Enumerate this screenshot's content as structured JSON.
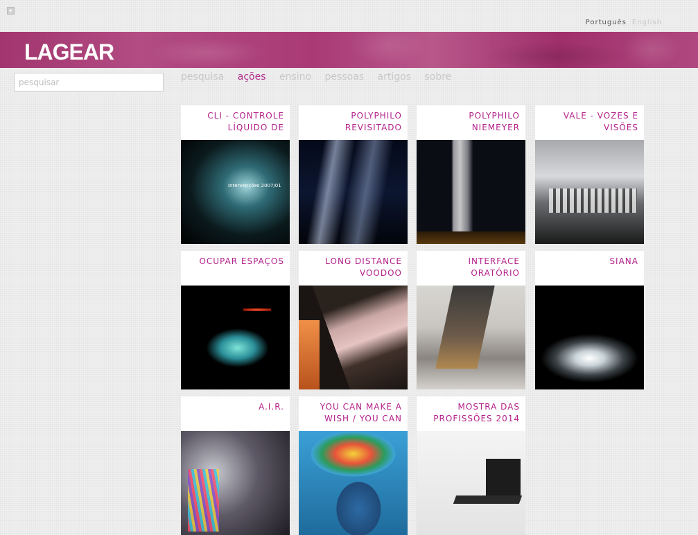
{
  "app": {
    "logo": "LAGEAR"
  },
  "languages": {
    "pt": "Português",
    "en": "English"
  },
  "search": {
    "placeholder": "pesquisar",
    "value": ""
  },
  "nav": [
    {
      "label": "pesquisa",
      "active": false
    },
    {
      "label": "ações",
      "active": true
    },
    {
      "label": "ensino",
      "active": false
    },
    {
      "label": "pessoas",
      "active": false
    },
    {
      "label": "artigos",
      "active": false
    },
    {
      "label": "sobre",
      "active": false
    }
  ],
  "colors": {
    "accent": "#b3218a",
    "banner": "#a93a76",
    "nav_inactive": "#c8c8c8"
  },
  "projects": [
    {
      "title": "CLI - CONTROLE LÍQUIDO DE",
      "image": "projection-tunnel-photo"
    },
    {
      "title": "POLYPHILO REVISITADO",
      "image": "projection-night-photo"
    },
    {
      "title": "POLYPHILO NIEMEYER",
      "image": "column-projection-photo"
    },
    {
      "title": "VALE - VOZES E VISÕES",
      "image": "stage-performance-photo"
    },
    {
      "title": "OCUPAR ESPAÇOS",
      "image": "light-projection-dark-photo"
    },
    {
      "title": "LONG DISTANCE VOODOO",
      "image": "street-projection-photo"
    },
    {
      "title": "INTERFACE ORATÓRIO",
      "image": "bamboo-workshop-photo"
    },
    {
      "title": "SIANA",
      "image": "glass-installation-photo"
    },
    {
      "title": "A.I.R.",
      "image": "colorful-object-photo"
    },
    {
      "title": "YOU CAN MAKE A WISH / YOU CAN",
      "image": "painted-face-photo"
    },
    {
      "title": "MOSTRA DAS PROFISSÕES 2014",
      "image": "white-exhibition-photo"
    }
  ]
}
